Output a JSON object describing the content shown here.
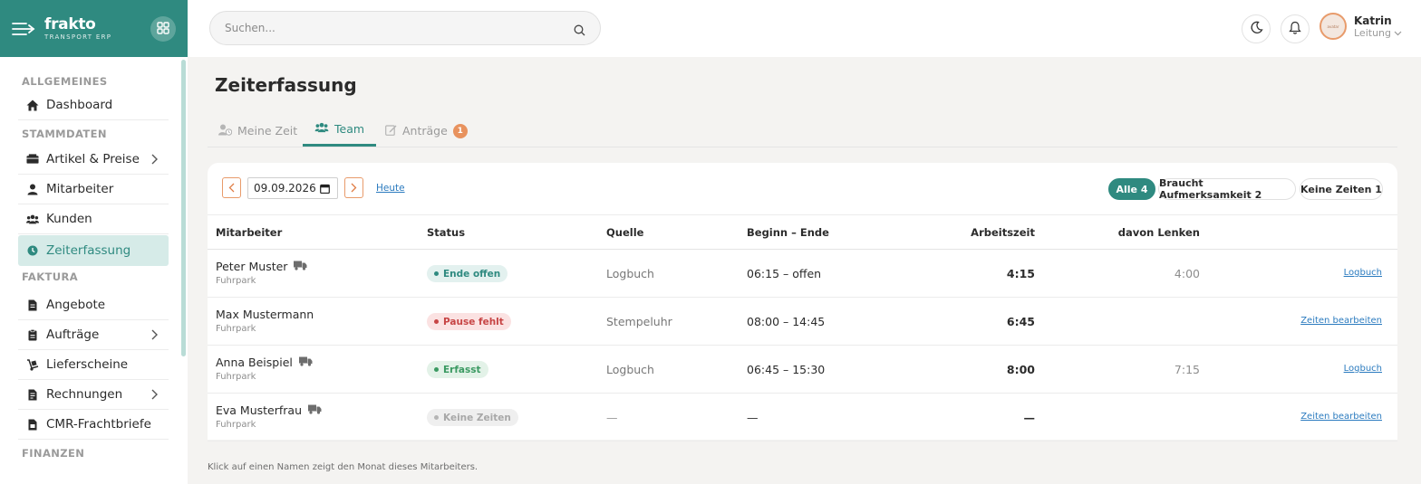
{
  "brand": {
    "name": "frakto",
    "subtitle": "TRANSPORT ERP"
  },
  "search": {
    "placeholder": "Suchen..."
  },
  "user": {
    "name": "Katrin",
    "role": "Leitung",
    "avatar_text": "avatar"
  },
  "sidebar": {
    "sections": [
      {
        "title": "ALLGEMEINES"
      },
      {
        "title": "STAMMDATEN"
      },
      {
        "title": "FAKTURA"
      },
      {
        "title": "FINANZEN"
      }
    ],
    "items": [
      {
        "label": "Dashboard",
        "icon": "home-icon"
      },
      {
        "label": "Artikel & Preise",
        "icon": "boxes-icon",
        "has_submenu": true
      },
      {
        "label": "Mitarbeiter",
        "icon": "user-icon"
      },
      {
        "label": "Kunden",
        "icon": "users-icon"
      },
      {
        "label": "Zeiterfassung",
        "icon": "clock-icon",
        "active": true
      },
      {
        "label": "Angebote",
        "icon": "document-icon"
      },
      {
        "label": "Aufträge",
        "icon": "clipboard-icon",
        "has_submenu": true
      },
      {
        "label": "Lieferscheine",
        "icon": "dolly-icon"
      },
      {
        "label": "Rechnungen",
        "icon": "invoice-icon",
        "has_submenu": true
      },
      {
        "label": "CMR-Frachtbriefe",
        "icon": "file-icon"
      }
    ]
  },
  "page": {
    "title": "Zeiterfassung"
  },
  "tabs": [
    {
      "label": "Meine Zeit",
      "icon": "user-clock-icon"
    },
    {
      "label": "Team",
      "icon": "users-icon",
      "active": true
    },
    {
      "label": "Anträge",
      "icon": "edit-icon",
      "count": "1"
    }
  ],
  "toolbar": {
    "date": "09.09.2026",
    "today_label": "Heute",
    "filters": [
      {
        "label": "Alle 4",
        "active": true
      },
      {
        "label": "Braucht Aufmerksamkeit 2"
      },
      {
        "label": "Keine Zeiten 1"
      }
    ]
  },
  "table": {
    "headers": {
      "employee": "Mitarbeiter",
      "status": "Status",
      "source": "Quelle",
      "range": "Beginn – Ende",
      "work": "Arbeitszeit",
      "driving": "davon Lenken"
    },
    "rows": [
      {
        "name": "Peter Muster",
        "truck": true,
        "dept": "Fuhrpark",
        "status": "Ende offen",
        "status_kind": "teal",
        "source": "Logbuch",
        "range": "06:15 – offen",
        "work": "4:15",
        "driving": "4:00",
        "action": "Logbuch"
      },
      {
        "name": "Max Mustermann",
        "truck": false,
        "dept": "Fuhrpark",
        "status": "Pause fehlt",
        "status_kind": "red",
        "source": "Stempeluhr",
        "range": "08:00 – 14:45",
        "work": "6:45",
        "driving": "",
        "action": "Zeiten bearbeiten"
      },
      {
        "name": "Anna Beispiel",
        "truck": true,
        "dept": "Fuhrpark",
        "status": "Erfasst",
        "status_kind": "green",
        "source": "Logbuch",
        "range": "06:45 – 15:30",
        "work": "8:00",
        "driving": "7:15",
        "action": "Logbuch"
      },
      {
        "name": "Eva Musterfrau",
        "truck": true,
        "dept": "Fuhrpark",
        "status": "Keine Zeiten",
        "status_kind": "grey",
        "source": "—",
        "range": "—",
        "work": "—",
        "driving": "",
        "action": "Zeiten bearbeiten"
      }
    ]
  },
  "footnote": "Klick auf einen Namen zeigt den Monat dieses Mitarbeiters.",
  "colors": {
    "brand": "#2f8a80",
    "accent": "#e8925e",
    "link": "#2b7bbf"
  }
}
